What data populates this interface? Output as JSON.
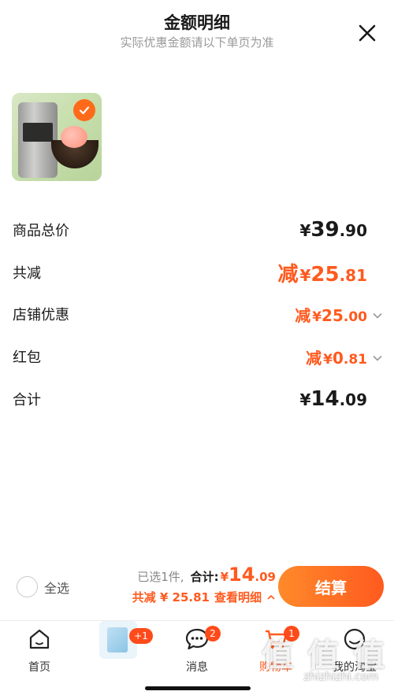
{
  "header": {
    "title": "金额明细",
    "subtitle": "实际优惠金额请以下单页为准"
  },
  "product": {
    "selected": true
  },
  "details": {
    "total_label": "商品总价",
    "total_currency": "¥",
    "total_int": "39",
    "total_dec": ".90",
    "reduce_label": "共减",
    "reduce_prefix": "减",
    "reduce_currency": "¥",
    "reduce_int": "25",
    "reduce_dec": ".81",
    "store_label": "店铺优惠",
    "store_prefix": "减",
    "store_currency": "¥",
    "store_int": "25",
    "store_dec": ".00",
    "redpacket_label": "红包",
    "redpacket_prefix": "减",
    "redpacket_currency": "¥",
    "redpacket_int": "0",
    "redpacket_dec": ".81",
    "sum_label": "合计",
    "sum_currency": "¥",
    "sum_int": "14",
    "sum_dec": ".09"
  },
  "bottom": {
    "select_all": "全选",
    "selected_count": "已选1件,",
    "sum_label": "合计:",
    "sum_currency": "¥",
    "sum_int": "14",
    "sum_dec": ".09",
    "reduce_text": "共减 ¥ 25.81",
    "view_detail": "查看明细",
    "checkout": "结算"
  },
  "tabbar": {
    "home": "首页",
    "promo_badge": "+1",
    "messages": "消息",
    "messages_badge": "2",
    "cart": "购物车",
    "cart_badge": "1",
    "mine": "我的淘宝"
  },
  "watermark": {
    "text": "值 值 值",
    "url": "zhizhizhi.com"
  },
  "colors": {
    "accent": "#ff5a1f",
    "text": "#1a1a1a",
    "muted": "#999999"
  }
}
